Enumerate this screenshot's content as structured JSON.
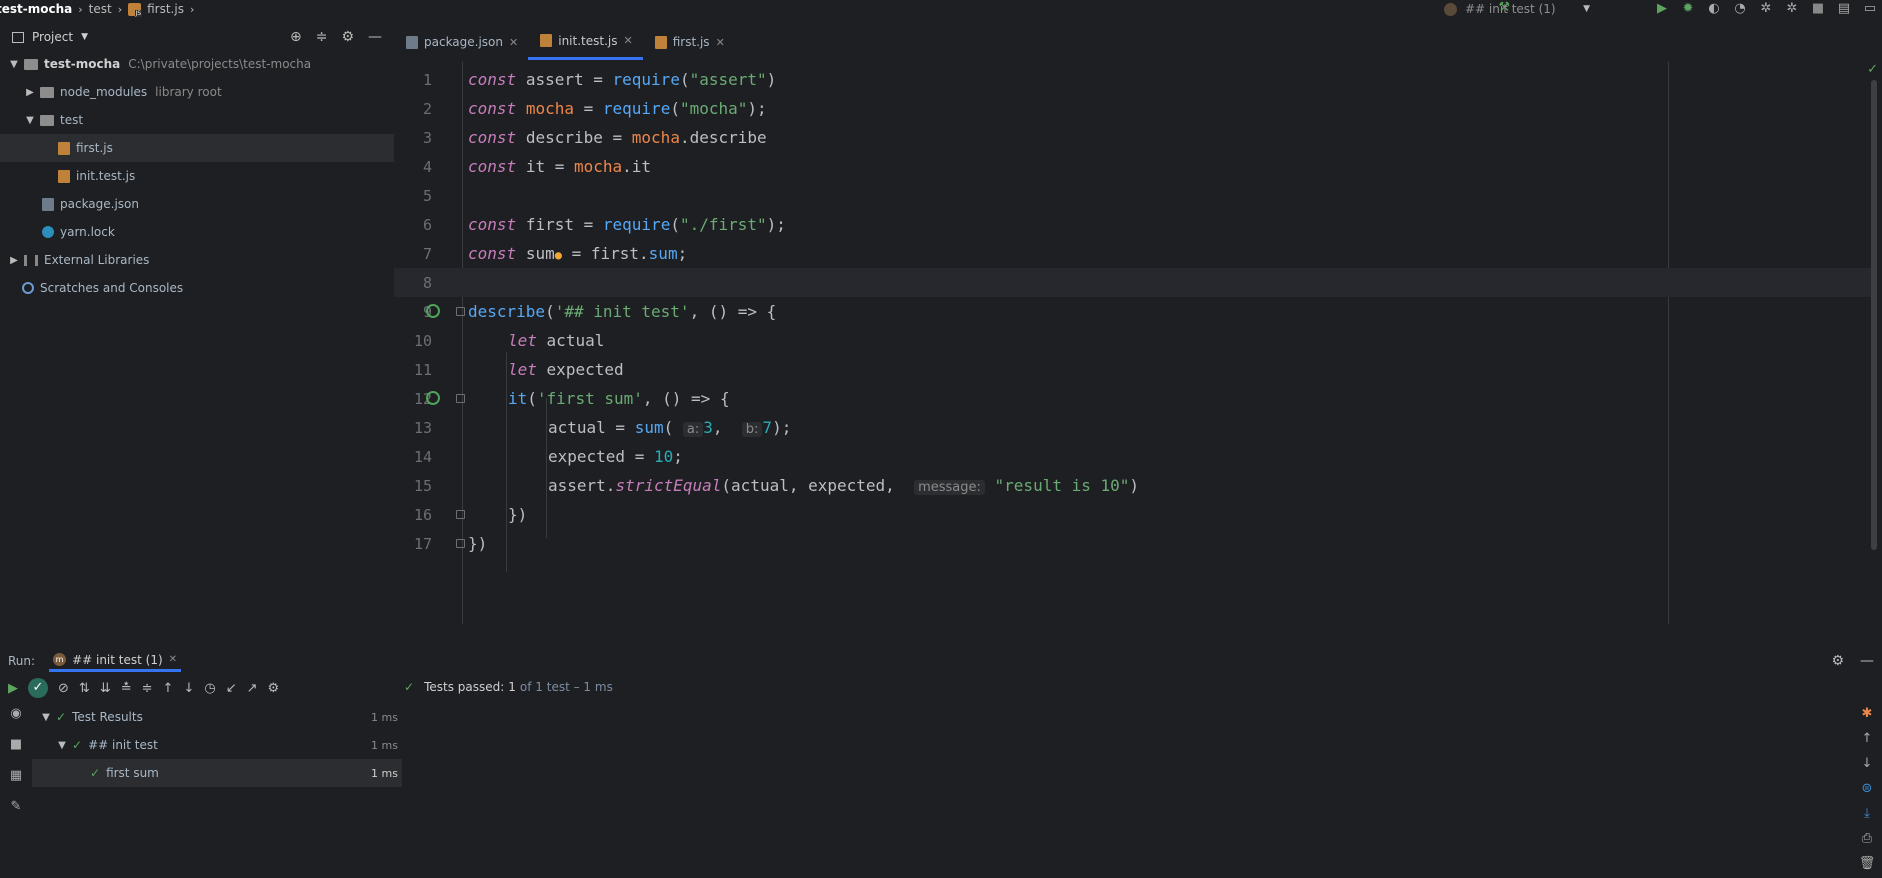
{
  "breadcrumb": {
    "project": "test-mocha",
    "folder": "test",
    "file": "first.js"
  },
  "run_config": {
    "label": "## init test (1)"
  },
  "project_panel": {
    "title": "Project",
    "tree": [
      {
        "label": "test-mocha",
        "detail": "C:\\private\\projects\\test-mocha"
      },
      {
        "label": "node_modules",
        "detail": "library root"
      },
      {
        "label": "test"
      },
      {
        "label": "first.js"
      },
      {
        "label": "init.test.js"
      },
      {
        "label": "package.json"
      },
      {
        "label": "yarn.lock"
      },
      {
        "label": "External Libraries"
      },
      {
        "label": "Scratches and Consoles"
      }
    ]
  },
  "tabs": [
    {
      "label": "package.json"
    },
    {
      "label": "init.test.js"
    },
    {
      "label": "first.js"
    }
  ],
  "code": {
    "line_numbers": [
      "1",
      "2",
      "3",
      "4",
      "5",
      "6",
      "7",
      "8",
      "9",
      "10",
      "11",
      "12",
      "13",
      "14",
      "15",
      "16",
      "17"
    ],
    "tokens": {
      "const": "const",
      "let": "let",
      "assert": "assert",
      "mocha": "mocha",
      "describe": "describe",
      "it": "it",
      "first": "first",
      "sum": "sum",
      "require": "require",
      "str_assert": "\"assert\"",
      "str_mocha": "\"mocha\"",
      "str_first": "\"./first\"",
      "str_init": "'## init test'",
      "str_firstsum": "'first sum'",
      "str_result": "\"result is 10\"",
      "actual": "actual",
      "expected": "expected",
      "strictEqual": "strictEqual",
      "hint_a": "a:",
      "hint_b": "b:",
      "hint_message": "message:",
      "n3": "3",
      "n7": "7",
      "n10": "10"
    }
  },
  "run_panel": {
    "label": "Run:",
    "tab": "## init test (1)",
    "status": {
      "prefix": "Tests passed:",
      "count": "1",
      "suffix": "of 1 test – 1 ms"
    },
    "results": [
      {
        "label": "Test Results",
        "time": "1 ms"
      },
      {
        "label": "## init test",
        "time": "1 ms"
      },
      {
        "label": "first sum",
        "time": "1 ms"
      }
    ]
  },
  "colors": {
    "accent": "#3574f0",
    "pass": "#5ba55f",
    "background": "#1e1f22"
  }
}
